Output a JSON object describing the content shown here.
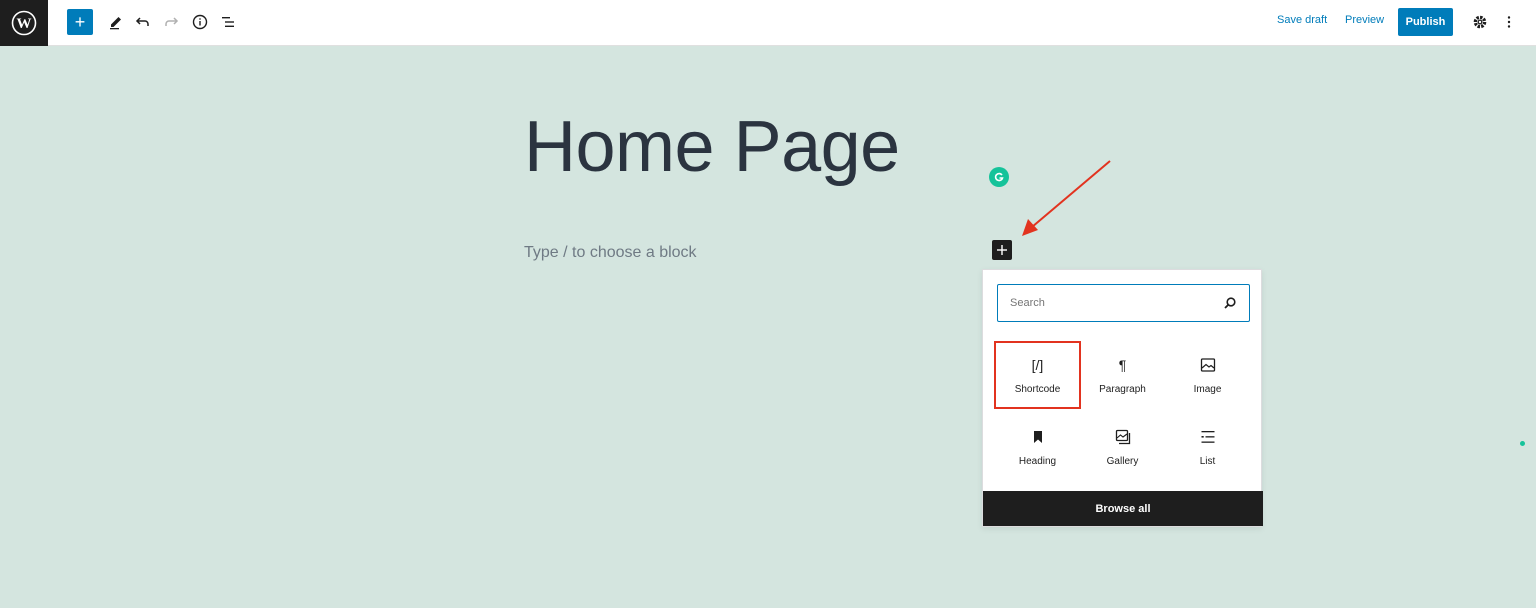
{
  "topbar": {
    "logo": "wordpress-logo",
    "add_block": "+",
    "save_draft": "Save draft",
    "preview": "Preview",
    "publish": "Publish"
  },
  "editor": {
    "title": "Home Page",
    "placeholder": "Type / to choose a block"
  },
  "inserter": {
    "search_placeholder": "Search",
    "blocks": [
      {
        "label": "Shortcode",
        "icon": "shortcode-icon",
        "glyph": "[/]",
        "highlighted": true
      },
      {
        "label": "Paragraph",
        "icon": "paragraph-icon",
        "glyph": "¶"
      },
      {
        "label": "Image",
        "icon": "image-icon"
      },
      {
        "label": "Heading",
        "icon": "bookmark-icon"
      },
      {
        "label": "Gallery",
        "icon": "gallery-icon"
      },
      {
        "label": "List",
        "icon": "list-icon"
      }
    ],
    "browse_all": "Browse all"
  },
  "colors": {
    "accent": "#007cba",
    "background": "#d4e5df",
    "highlight": "#e2331f",
    "grammarly": "#15c39a"
  }
}
